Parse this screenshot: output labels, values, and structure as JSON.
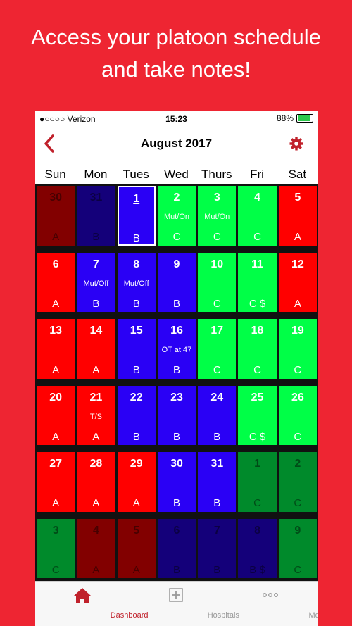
{
  "headline": [
    "Access your platoon schedule",
    "and take notes!"
  ],
  "status_bar": {
    "carrier": "●○○○○ Verizon",
    "time": "15:23",
    "battery": "88%"
  },
  "navbar": {
    "title": "August 2017",
    "back_icon": "chevron-left-icon",
    "settings_icon": "gear-icon"
  },
  "weekdays": [
    "Sun",
    "Mon",
    "Tues",
    "Wed",
    "Thurs",
    "Fri",
    "Sat"
  ],
  "colors": {
    "A": "#ff0000",
    "B": "#2a00f5",
    "C": "#00ff47",
    "A_dim": "#820000",
    "B_dim": "#14007a",
    "C_dim": "#008a2b",
    "accent": "#c0212b"
  },
  "weeks": [
    [
      {
        "date": "30",
        "note": "",
        "platoon": "A",
        "color": "A_dim",
        "dim": true
      },
      {
        "date": "31",
        "note": "",
        "platoon": "B",
        "color": "B_dim",
        "dim": true
      },
      {
        "date": "1",
        "note": "",
        "platoon": "B",
        "color": "B",
        "today": true
      },
      {
        "date": "2",
        "note": "Mut/On",
        "platoon": "C",
        "color": "C"
      },
      {
        "date": "3",
        "note": "Mut/On",
        "platoon": "C",
        "color": "C"
      },
      {
        "date": "4",
        "note": "",
        "platoon": "C",
        "color": "C"
      },
      {
        "date": "5",
        "note": "",
        "platoon": "A",
        "color": "A"
      }
    ],
    [
      {
        "date": "6",
        "note": "",
        "platoon": "A",
        "color": "A"
      },
      {
        "date": "7",
        "note": "Mut/Off",
        "platoon": "B",
        "color": "B"
      },
      {
        "date": "8",
        "note": "Mut/Off",
        "platoon": "B",
        "color": "B"
      },
      {
        "date": "9",
        "note": "",
        "platoon": "B",
        "color": "B"
      },
      {
        "date": "10",
        "note": "",
        "platoon": "C",
        "color": "C"
      },
      {
        "date": "11",
        "note": "",
        "platoon": "C $",
        "color": "C"
      },
      {
        "date": "12",
        "note": "",
        "platoon": "A",
        "color": "A"
      }
    ],
    [
      {
        "date": "13",
        "note": "",
        "platoon": "A",
        "color": "A"
      },
      {
        "date": "14",
        "note": "",
        "platoon": "A",
        "color": "A"
      },
      {
        "date": "15",
        "note": "",
        "platoon": "B",
        "color": "B"
      },
      {
        "date": "16",
        "note": "OT at 47",
        "platoon": "B",
        "color": "B"
      },
      {
        "date": "17",
        "note": "",
        "platoon": "C",
        "color": "C"
      },
      {
        "date": "18",
        "note": "",
        "platoon": "C",
        "color": "C"
      },
      {
        "date": "19",
        "note": "",
        "platoon": "C",
        "color": "C"
      }
    ],
    [
      {
        "date": "20",
        "note": "",
        "platoon": "A",
        "color": "A"
      },
      {
        "date": "21",
        "note": "T/S",
        "platoon": "A",
        "color": "A"
      },
      {
        "date": "22",
        "note": "",
        "platoon": "B",
        "color": "B"
      },
      {
        "date": "23",
        "note": "",
        "platoon": "B",
        "color": "B"
      },
      {
        "date": "24",
        "note": "",
        "platoon": "B",
        "color": "B"
      },
      {
        "date": "25",
        "note": "",
        "platoon": "C $",
        "color": "C"
      },
      {
        "date": "26",
        "note": "",
        "platoon": "C",
        "color": "C"
      }
    ],
    [
      {
        "date": "27",
        "note": "",
        "platoon": "A",
        "color": "A"
      },
      {
        "date": "28",
        "note": "",
        "platoon": "A",
        "color": "A"
      },
      {
        "date": "29",
        "note": "",
        "platoon": "A",
        "color": "A"
      },
      {
        "date": "30",
        "note": "",
        "platoon": "B",
        "color": "B"
      },
      {
        "date": "31",
        "note": "",
        "platoon": "B",
        "color": "B"
      },
      {
        "date": "1",
        "note": "",
        "platoon": "C",
        "color": "C_dim",
        "dim": true
      },
      {
        "date": "2",
        "note": "",
        "platoon": "C",
        "color": "C_dim",
        "dim": true
      }
    ],
    [
      {
        "date": "3",
        "note": "",
        "platoon": "C",
        "color": "C_dim",
        "dim": true
      },
      {
        "date": "4",
        "note": "",
        "platoon": "A",
        "color": "A_dim",
        "dim": true
      },
      {
        "date": "5",
        "note": "",
        "platoon": "A",
        "color": "A_dim",
        "dim": true
      },
      {
        "date": "6",
        "note": "",
        "platoon": "B",
        "color": "B_dim",
        "dim": true
      },
      {
        "date": "7",
        "note": "",
        "platoon": "B",
        "color": "B_dim",
        "dim": true
      },
      {
        "date": "8",
        "note": "",
        "platoon": "B $",
        "color": "B_dim",
        "dim": true
      },
      {
        "date": "9",
        "note": "",
        "platoon": "C",
        "color": "C_dim",
        "dim": true
      }
    ]
  ],
  "tabs": [
    {
      "label": "Dashboard",
      "icon": "home-icon",
      "active": true
    },
    {
      "label": "Hospitals",
      "icon": "plus-square-icon",
      "active": false
    },
    {
      "label": "More",
      "icon": "more-dots-icon",
      "active": false
    }
  ]
}
